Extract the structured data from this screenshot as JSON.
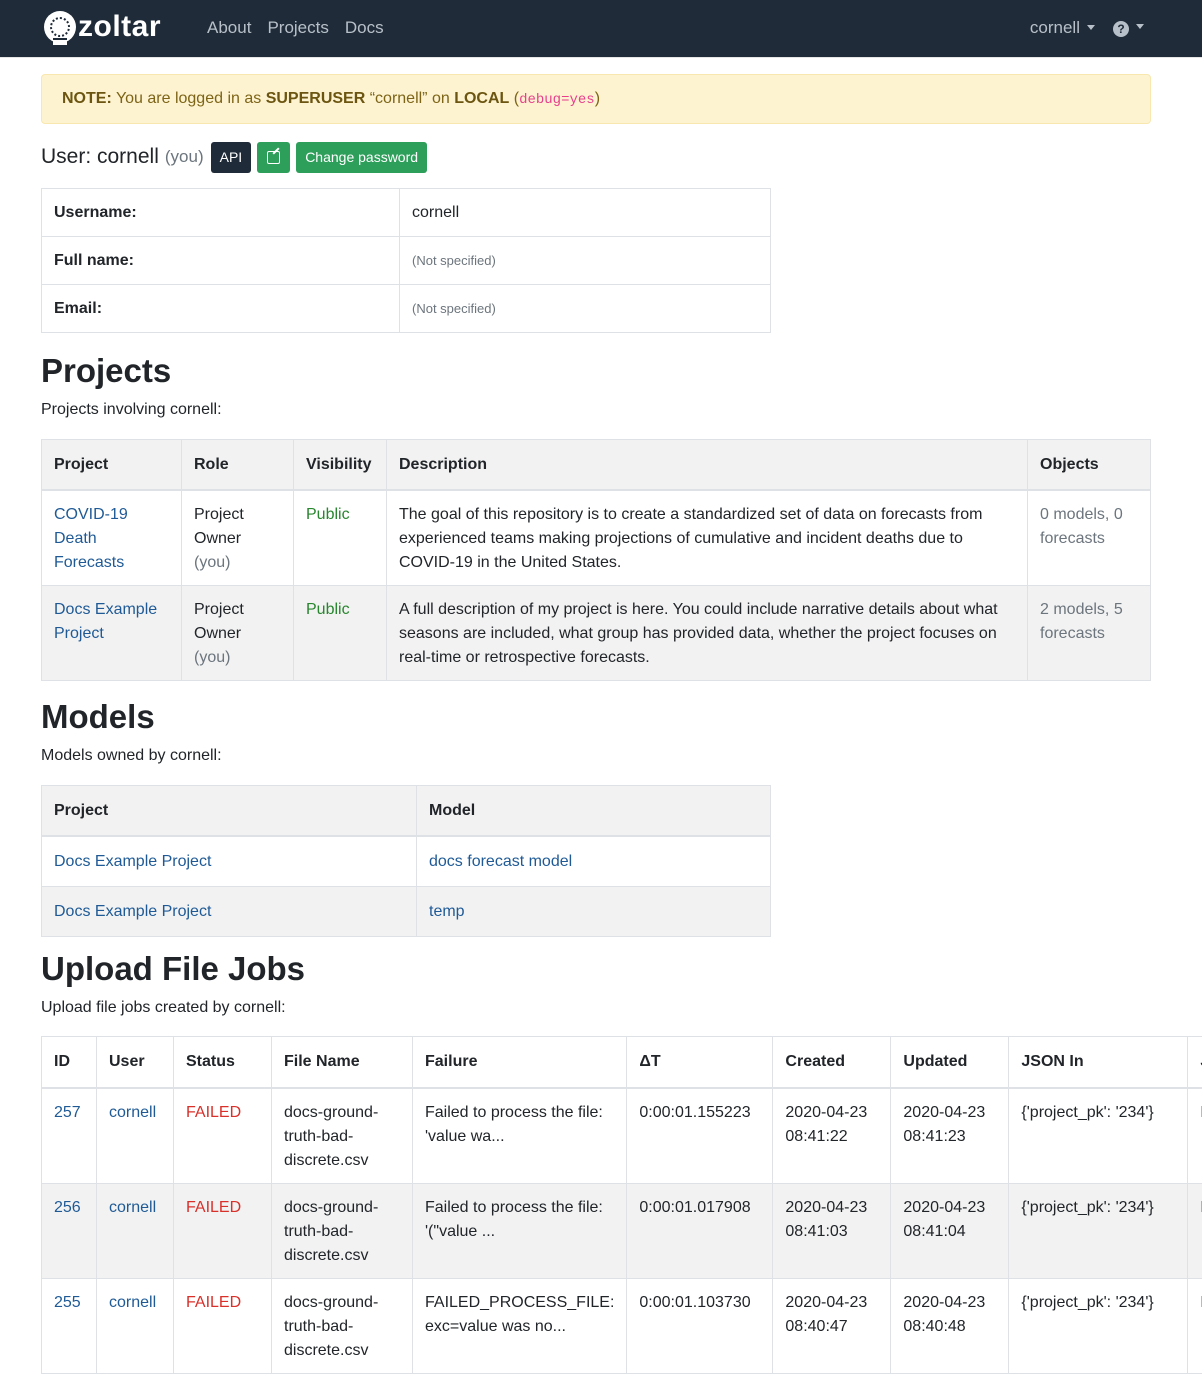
{
  "nav": {
    "brand": "zoltar",
    "links": [
      "About",
      "Projects",
      "Docs"
    ],
    "user": "cornell",
    "help_icon": "question-circle-icon"
  },
  "note": {
    "label": "NOTE:",
    "t1": " You are logged in as ",
    "role": "SUPERUSER",
    "t2": " “cornell” on ",
    "env": "LOCAL",
    "t3": " (",
    "debug": "debug=yes",
    "t4": ")"
  },
  "user": {
    "title": "User: cornell",
    "you": "(you)",
    "api_label": "API",
    "edit_icon": "edit-icon",
    "change_password_label": "Change password"
  },
  "info": [
    {
      "key": "Username:",
      "value": "cornell"
    },
    {
      "key": "Full name:",
      "value": "(Not specified)"
    },
    {
      "key": "Email:",
      "value": "(Not specified)"
    }
  ],
  "projects": {
    "heading": "Projects",
    "subtitle": "Projects involving cornell:",
    "columns": [
      "Project",
      "Role",
      "Visibility",
      "Description",
      "Objects"
    ],
    "rows": [
      {
        "project": "COVID-19 Death Forecasts",
        "role": "Project Owner",
        "role_you": "(you)",
        "visibility": "Public",
        "description": "The goal of this repository is to create a standardized set of data on forecasts from experienced teams making projections of cumulative and incident deaths due to COVID-19 in the United States.",
        "objects": "0 models, 0 forecasts"
      },
      {
        "project": "Docs Example Project",
        "role": "Project Owner",
        "role_you": "(you)",
        "visibility": "Public",
        "description": "A full description of my project is here. You could include narrative details about what seasons are included, what group has provided data, whether the project focuses on real-time or retrospective forecasts.",
        "objects": "2 models, 5 forecasts"
      }
    ]
  },
  "models": {
    "heading": "Models",
    "subtitle": "Models owned by cornell:",
    "columns": [
      "Project",
      "Model"
    ],
    "rows": [
      {
        "project": "Docs Example Project",
        "model": "docs forecast model"
      },
      {
        "project": "Docs Example Project",
        "model": "temp"
      }
    ]
  },
  "jobs": {
    "heading": "Upload File Jobs",
    "subtitle": "Upload file jobs created by cornell:",
    "columns": [
      "ID",
      "User",
      "Status",
      "File Name",
      "Failure",
      "ΔT",
      "Created",
      "Updated",
      "JSON In",
      "JSON Out"
    ],
    "rows": [
      {
        "id": "257",
        "user": "cornell",
        "status": "FAILED",
        "file": "docs-ground-truth-bad-discrete.csv",
        "failure": "Failed to process the file: 'value wa...",
        "dt": "0:00:01.155223",
        "created": "2020-04-23 08:41:22",
        "updated": "2020-04-23 08:41:23",
        "json_in": "{'project_pk': '234'}",
        "json_out": "None"
      },
      {
        "id": "256",
        "user": "cornell",
        "status": "FAILED",
        "file": "docs-ground-truth-bad-discrete.csv",
        "failure": "Failed to process the file: '(\"value ...",
        "dt": "0:00:01.017908",
        "created": "2020-04-23 08:41:03",
        "updated": "2020-04-23 08:41:04",
        "json_in": "{'project_pk': '234'}",
        "json_out": "None"
      },
      {
        "id": "255",
        "user": "cornell",
        "status": "FAILED",
        "file": "docs-ground-truth-bad-discrete.csv",
        "failure": "FAILED_PROCESS_FILE: exc=value was no...",
        "dt": "0:00:01.103730",
        "created": "2020-04-23 08:40:47",
        "updated": "2020-04-23 08:40:48",
        "json_in": "{'project_pk': '234'}",
        "json_out": "None"
      }
    ]
  }
}
